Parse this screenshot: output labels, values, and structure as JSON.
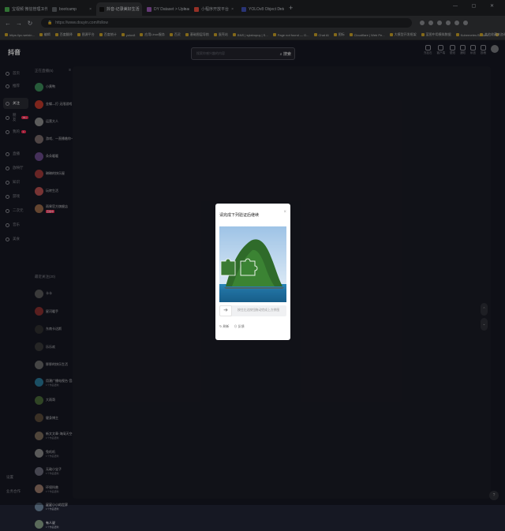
{
  "browser": {
    "tabs": [
      {
        "title": "宝视频 微信管理工作",
        "color": "#4caf50",
        "active": false
      },
      {
        "title": "bootcamp",
        "color": "#5f6368",
        "active": false
      },
      {
        "title": "抖音-记录美好生活",
        "color": "#111111",
        "active": true
      },
      {
        "title": "DY Dataset > Upload",
        "color": "#9b59b6",
        "active": false
      },
      {
        "title": "小程序开放平台",
        "color": "#e74c3c",
        "active": false
      },
      {
        "title": "YOLOv8 Object Detection",
        "color": "#3f51b5",
        "active": false
      }
    ],
    "new_tab": "+",
    "window_controls": "— ▢ ✕",
    "url": "https://www.douyin.com/follow",
    "bookmarks": [
      "https://pc.weixin...",
      "编辑",
      "百度翻译",
      "图源平台",
      "百度统计",
      "yolov8",
      "应用Linux服务",
      "百灵",
      "基础图层导航",
      "蛋壳站",
      "BNS | sylabopuy | S...",
      "Page not found — G...",
      "Chat AI",
      "图标",
      "Cloudflare | Web Pe...",
      "大模型开发框架",
      "蓝图中用模拟数据",
      "Kubernetes Backbo...",
      "咨询服务平台",
      "机器学习",
      "网站",
      "其他收藏夹"
    ]
  },
  "header": {
    "logo": "抖音",
    "search_placeholder": "搜索你感兴趣的内容",
    "search_button": "搜索",
    "icons": [
      {
        "name": "recharge-icon",
        "label": "充钻石"
      },
      {
        "name": "client-icon",
        "label": "客户端"
      },
      {
        "name": "wallpaper-icon",
        "label": "壁纸"
      },
      {
        "name": "notice-icon",
        "label": "通知"
      },
      {
        "name": "message-icon",
        "label": "私信"
      },
      {
        "name": "publish-icon",
        "label": "投稿"
      }
    ]
  },
  "left_nav": [
    {
      "label": "首页",
      "active": false
    },
    {
      "label": "推荐",
      "active": false
    },
    {
      "label": "关注",
      "active": true
    },
    {
      "label": "朋友",
      "active": false,
      "badge": "99+"
    },
    {
      "label": "我的",
      "active": false,
      "badge": "1"
    },
    {
      "label": "直播",
      "active": false
    },
    {
      "label": "放映厅",
      "active": false
    },
    {
      "label": "知识",
      "active": false
    },
    {
      "label": "游戏",
      "active": false
    },
    {
      "label": "二次元",
      "active": false
    },
    {
      "label": "音乐",
      "active": false
    },
    {
      "label": "美食",
      "active": false
    }
  ],
  "left_nav_bottom": [
    "设置",
    "业务合作"
  ],
  "follow_panel": {
    "title": "正在直播(5)",
    "live_items": [
      {
        "name": "小黄鸭",
        "color": "#3c8d5a"
      },
      {
        "name": "金蝶—打·无限游戏",
        "color": "#c0392b"
      },
      {
        "name": "运营大人",
        "color": "#8e8e8e"
      },
      {
        "name": "游戏、一直播着你一",
        "color": "#7a6a6a"
      },
      {
        "name": "朵朵暖暖",
        "color": "#6a4a8a"
      },
      {
        "name": "琳琳的快乐屋",
        "color": "#a03a3a"
      },
      {
        "name": "玩转生活",
        "color": "#b85050"
      },
      {
        "name": "雨果官方旗舰店",
        "color": "#9a6a4a",
        "live": "直播中"
      }
    ],
    "subtitle": "最近关注(20)",
    "recent_items": [
      {
        "name": "卡卡",
        "color": "#5a5a5a"
      },
      {
        "name": "星河暖手",
        "color": "#8a3030"
      },
      {
        "name": "东南卡达斯",
        "color": "#303030"
      },
      {
        "name": "乐乐欢",
        "color": "#3a3a3a"
      },
      {
        "name": "胖胖的快乐生活",
        "color": "#6a6a6a"
      },
      {
        "name": "用潮广播电视台·音乐",
        "color": "#2a7a9a",
        "status": "1个作品更新"
      },
      {
        "name": "大雨哥",
        "color": "#4a6a3a"
      },
      {
        "name": "健身博主",
        "color": "#5a4a3a"
      },
      {
        "name": "新文文章·海阔天空一",
        "color": "#7a6a5a",
        "status": "1个作品更新"
      },
      {
        "name": "兔叽叽",
        "color": "#8a8a8a",
        "status": "1个作品更新"
      },
      {
        "name": "无敌小宝子",
        "color": "#6a6a7a",
        "status": "1个作品更新"
      },
      {
        "name": "环境科普",
        "color": "#9a7a6a",
        "status": "1个作品更新"
      },
      {
        "name": "星星小小的世界",
        "color": "#4a5a6a",
        "status": "1个作品更新"
      },
      {
        "name": "有人说",
        "color": "#5a6a5a",
        "status": "1个作品更新"
      }
    ]
  },
  "captcha": {
    "title": "请完成下列验证后继续",
    "close": "×",
    "slider_hint": "按住左边按钮拖动完成上方拼图",
    "refresh": "刷新",
    "feedback": "反馈"
  },
  "scroll_buttons": [
    "⌃",
    "⌄"
  ],
  "fab": "?"
}
